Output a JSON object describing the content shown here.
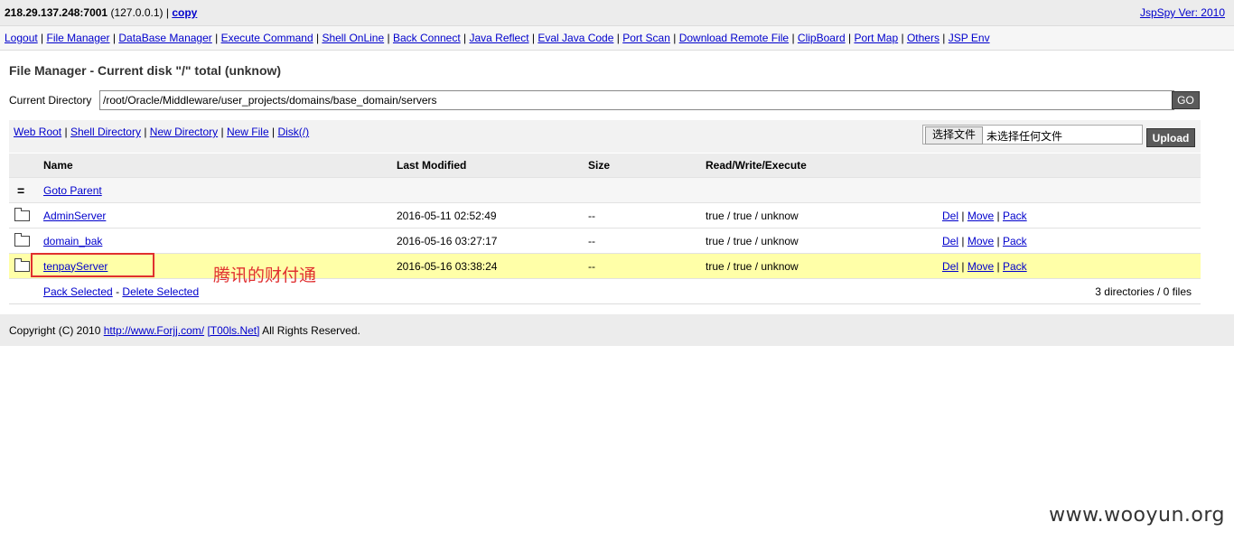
{
  "header": {
    "host": "218.29.137.248:7001",
    "local_ip": "(127.0.0.1)",
    "sep": "|",
    "copy_label": "copy",
    "version": "JspSpy Ver: 2010"
  },
  "nav": {
    "items": [
      "Logout",
      "File Manager",
      "DataBase Manager",
      "Execute Command",
      "Shell OnLine",
      "Back Connect",
      "Java Reflect",
      "Eval Java Code",
      "Port Scan",
      "Download Remote File",
      "ClipBoard",
      "Port Map",
      "Others",
      "JSP Env"
    ]
  },
  "page": {
    "title": "File Manager - Current disk \"/\" total (unknow)",
    "current_dir_label": "Current Directory",
    "current_dir_value": "/root/Oracle/Middleware/user_projects/domains/base_domain/servers",
    "go_label": "GO"
  },
  "toolbar": {
    "links": [
      "Web Root",
      "Shell Directory",
      "New Directory",
      "New File",
      "Disk(/)"
    ],
    "choose_file_label": "选择文件",
    "no_file_label": "未选择任何文件",
    "upload_label": "Upload"
  },
  "table": {
    "headers": {
      "name": "Name",
      "modified": "Last Modified",
      "size": "Size",
      "rwx": "Read/Write/Execute"
    },
    "parent": {
      "icon": "=",
      "label": "Goto Parent"
    },
    "rows": [
      {
        "name": "AdminServer",
        "modified": "2016-05-11 02:52:49",
        "size": "--",
        "rwx": "true / true / unknow",
        "del": "Del",
        "move": "Move",
        "pack": "Pack",
        "sep": "|"
      },
      {
        "name": "domain_bak",
        "modified": "2016-05-16 03:27:17",
        "size": "--",
        "rwx": "true / true / unknow",
        "del": "Del",
        "move": "Move",
        "pack": "Pack",
        "sep": "|"
      },
      {
        "name": "tenpayServer",
        "modified": "2016-05-16 03:38:24",
        "size": "--",
        "rwx": "true / true / unknow",
        "del": "Del",
        "move": "Move",
        "pack": "Pack",
        "sep": "|"
      }
    ],
    "footer": {
      "pack_selected": "Pack Selected",
      "dash": "-",
      "delete_selected": "Delete Selected",
      "count": "3 directories / 0 files"
    }
  },
  "annotation": {
    "text": "腾讯的财付通",
    "color": "#e03030"
  },
  "copyright": {
    "prefix": "Copyright (C) 2010",
    "link1": "http://www.Forjj.com/",
    "link2": "[T00ls.Net]",
    "suffix": "All Rights Reserved."
  },
  "watermark": "www.wooyun.org",
  "colors": {
    "link": "#0000cc",
    "highlight_row": "#ffffa8",
    "button": "#5a5a5a",
    "header_bg": "#ececec"
  }
}
